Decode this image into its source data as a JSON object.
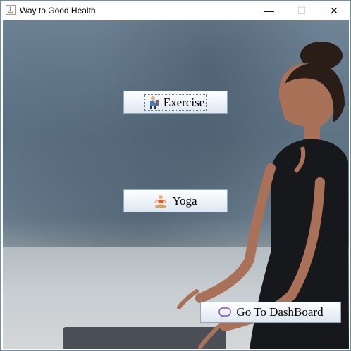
{
  "window": {
    "title": "Way to Good Health",
    "controls": {
      "minimize": "—",
      "maximize": "☐",
      "close": "✕"
    }
  },
  "buttons": {
    "exercise": {
      "label": "Exercise",
      "icon": "exercise-person-icon"
    },
    "yoga": {
      "label": "Yoga",
      "icon": "yoga-pose-icon"
    },
    "dashboard": {
      "label": "Go To DashBoard",
      "icon": "dashboard-icon"
    }
  },
  "background": {
    "description_icon": "meditation-photo"
  },
  "colors": {
    "button_border": "#8aa6c1",
    "window_border": "#6a8fb5"
  }
}
